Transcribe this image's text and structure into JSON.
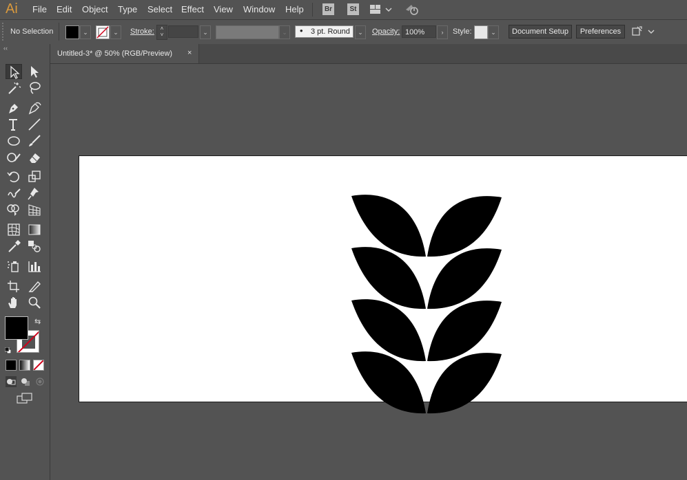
{
  "app": {
    "logo": "Ai"
  },
  "menu": {
    "items": [
      "File",
      "Edit",
      "Object",
      "Type",
      "Select",
      "Effect",
      "View",
      "Window",
      "Help"
    ],
    "bridge": "Br",
    "stock": "St"
  },
  "control_bar": {
    "selection_status": "No Selection",
    "fill_color": "#000000",
    "stroke_label": "Stroke:",
    "stroke_weight_value": "",
    "brush_label": "3 pt. Round",
    "opacity_label": "Opacity:",
    "opacity_value": "100%",
    "style_label": "Style:",
    "document_setup": "Document Setup",
    "preferences": "Preferences"
  },
  "document": {
    "tab_title": "Untitled-3* @ 50% (RGB/Preview)",
    "close_glyph": "×"
  },
  "toolbox": {
    "collapse_glyph": "‹‹",
    "fill_color": "#000000",
    "stroke_color": "none"
  },
  "colors": {
    "accent_logo": "#d9993d",
    "ui_background": "#535353",
    "artboard": "#ffffff",
    "art_fill": "#000000"
  }
}
